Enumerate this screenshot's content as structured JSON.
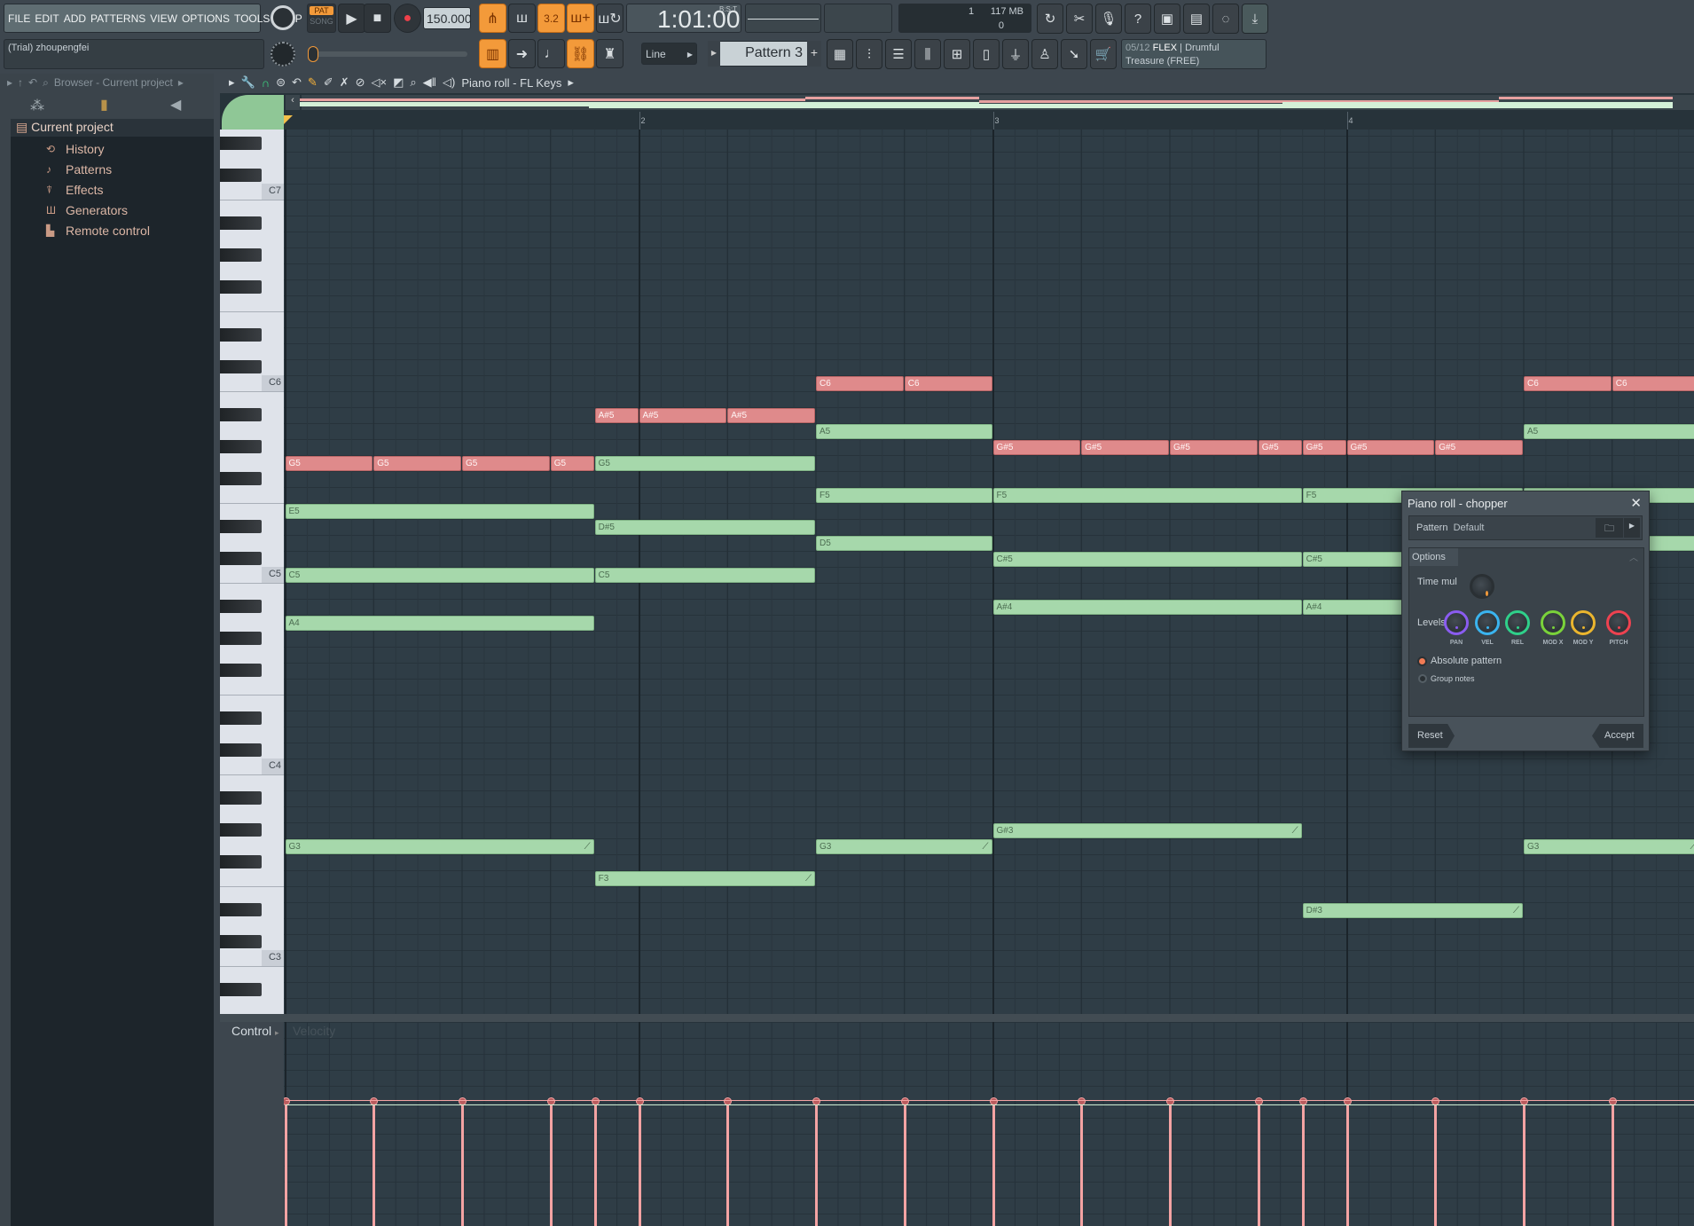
{
  "menu": [
    "FILE",
    "EDIT",
    "ADD",
    "PATTERNS",
    "VIEW",
    "OPTIONS",
    "TOOLS",
    "HELP"
  ],
  "transport": {
    "pat": "PAT",
    "song": "SONG",
    "tempo": "150.000",
    "time": "1:01:00",
    "time_format": "B:S:T"
  },
  "monitor": {
    "voices": "1",
    "memory": "117 MB",
    "cpu": "0"
  },
  "hint": {
    "text": "(Trial) zhoupengfei"
  },
  "snap": {
    "value": "Line"
  },
  "pattern": {
    "name": "Pattern 3",
    "add": "+"
  },
  "news": {
    "line1a": "05/12",
    "line1b": "FLEX",
    "line1c": "| Drumful",
    "line2": "Treasure (FREE)"
  },
  "browser": {
    "title": "Browser - Current project",
    "root": "Current project",
    "items": [
      {
        "label": "History",
        "icon": "history-icon",
        "glyph": "⟲"
      },
      {
        "label": "Patterns",
        "icon": "note-icon",
        "glyph": "♪"
      },
      {
        "label": "Effects",
        "icon": "effects-icon",
        "glyph": "⍒"
      },
      {
        "label": "Generators",
        "icon": "piano-icon",
        "glyph": "Ш"
      },
      {
        "label": "Remote control",
        "icon": "remote-icon",
        "glyph": "▙"
      }
    ]
  },
  "pianoroll": {
    "title": "Piano roll - FL Keys",
    "bars": [
      "2",
      "3",
      "4"
    ],
    "key_labels": [
      "C7",
      "C6",
      "C5",
      "C4",
      "C3"
    ],
    "control_label": "Control",
    "control_target": "Velocity"
  },
  "colors": {
    "selected_note": "#df8a8b",
    "note": "#a6d8ab",
    "accent": "#f39a3a"
  },
  "notes": [
    [
      "C6",
      6,
      1,
      1
    ],
    [
      "C6",
      7,
      1,
      1
    ],
    [
      "C6",
      14,
      1,
      1
    ],
    [
      "C6",
      15,
      1,
      1
    ],
    [
      "A#5",
      3.5,
      0.5,
      1
    ],
    [
      "A#5",
      4,
      1,
      1
    ],
    [
      "A#5",
      5,
      1,
      1
    ],
    [
      "A5",
      6,
      2,
      0
    ],
    [
      "A5",
      14,
      2,
      0
    ],
    [
      "G#5",
      8,
      1,
      1
    ],
    [
      "G#5",
      9,
      1,
      1
    ],
    [
      "G#5",
      10,
      1,
      1
    ],
    [
      "G#5",
      11,
      0.5,
      1
    ],
    [
      "G#5",
      11.5,
      0.5,
      1
    ],
    [
      "G#5",
      12,
      1,
      1
    ],
    [
      "G#5",
      13,
      1,
      1
    ],
    [
      "G5",
      0,
      1,
      1
    ],
    [
      "G5",
      1,
      1,
      1
    ],
    [
      "G5",
      2,
      1,
      1
    ],
    [
      "G5",
      3,
      0.5,
      1
    ],
    [
      "G5",
      3.5,
      2.5,
      0
    ],
    [
      "F5",
      6,
      2,
      0
    ],
    [
      "F5",
      8,
      3.5,
      0
    ],
    [
      "F5",
      11.5,
      2.5,
      0
    ],
    [
      "F5",
      14,
      2,
      0
    ],
    [
      "E5",
      0,
      3.5,
      0
    ],
    [
      "D#5",
      3.5,
      2.5,
      0
    ],
    [
      "D5",
      6,
      2,
      0
    ],
    [
      "D5",
      14,
      2,
      0
    ],
    [
      "C#5",
      8,
      3.5,
      0
    ],
    [
      "C#5",
      11.5,
      2.5,
      0
    ],
    [
      "C5",
      0,
      3.5,
      0
    ],
    [
      "C5",
      3.5,
      2.5,
      0
    ],
    [
      "A#4",
      8,
      3.5,
      0
    ],
    [
      "A#4",
      11.5,
      2.5,
      0
    ],
    [
      "A4",
      0,
      3.5,
      0
    ],
    [
      "G#3",
      8,
      3.5,
      0
    ],
    [
      "G3",
      0,
      3.5,
      0
    ],
    [
      "G3",
      6,
      2,
      0
    ],
    [
      "G3",
      14,
      2,
      0
    ],
    [
      "F3",
      3.5,
      2.5,
      0
    ],
    [
      "D#3",
      11.5,
      2.5,
      0
    ]
  ],
  "velocity": {
    "selected": 0.79,
    "normal": 0.76
  },
  "chopper": {
    "title": "Piano roll - chopper",
    "pattern_label": "Pattern",
    "pattern_value": "Default",
    "options": "Options",
    "time_mul": "Time mul",
    "levels": "Levels",
    "knobs": [
      {
        "label": "PAN",
        "color": "#8a5cf0"
      },
      {
        "label": "VEL",
        "color": "#3ab4ef"
      },
      {
        "label": "REL",
        "color": "#2fd08a"
      },
      {
        "label": "MOD X",
        "color": "#7ad23a"
      },
      {
        "label": "MOD Y",
        "color": "#eab52e"
      },
      {
        "label": "PITCH",
        "color": "#ee4250"
      }
    ],
    "absolute": "Absolute pattern",
    "absolute_checked": true,
    "group": "Group notes",
    "group_checked": false,
    "reset": "Reset",
    "accept": "Accept"
  }
}
